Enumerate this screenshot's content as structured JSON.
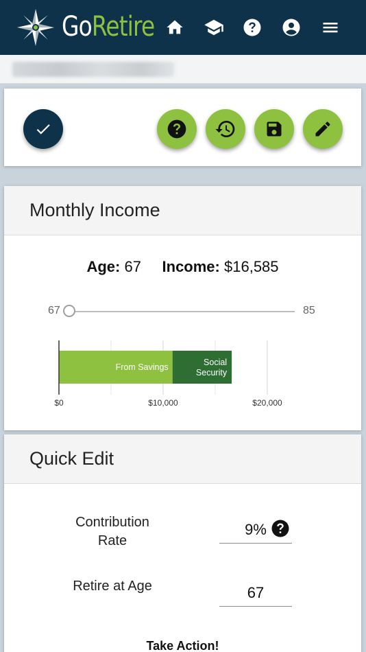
{
  "header": {
    "brand_part1": "Go",
    "brand_part2": "Retire",
    "nav_icons": [
      "home-icon",
      "graduation-cap-icon",
      "help-icon",
      "account-circle-icon",
      "menu-icon"
    ],
    "colors": {
      "header_bg": "#0e3249",
      "accent": "#8dc13f"
    }
  },
  "toolbar": {
    "confirm_icon": "check-icon",
    "actions": [
      "help-icon",
      "history-icon",
      "save-icon",
      "edit-icon"
    ]
  },
  "monthly_income": {
    "title": "Monthly Income",
    "age_label": "Age:",
    "age_value": "67",
    "income_label": "Income:",
    "income_value": "$16,585",
    "slider_min": "67",
    "slider_max": "85",
    "slider_value_fraction": 0
  },
  "chart_data": {
    "type": "bar",
    "orientation": "horizontal",
    "stacked": true,
    "categories": [
      ""
    ],
    "series": [
      {
        "name": "From Savings",
        "values": [
          10900
        ],
        "color": "#8dc13f",
        "label": "From Savings"
      },
      {
        "name": "Social Security",
        "values": [
          5685
        ],
        "color": "#2f6e33",
        "label": "Social Security"
      }
    ],
    "xlim": [
      0,
      20000
    ],
    "xticks": [
      "$0",
      "$10,000",
      "$20,000"
    ],
    "minor_gridlines": [
      5000,
      15000
    ],
    "grid": true
  },
  "quick_edit": {
    "title": "Quick Edit",
    "contribution_label": "Contribution Rate",
    "contribution_value": "9%",
    "retire_label": "Retire at Age",
    "retire_value": "67",
    "take_action": "Take Action!"
  }
}
